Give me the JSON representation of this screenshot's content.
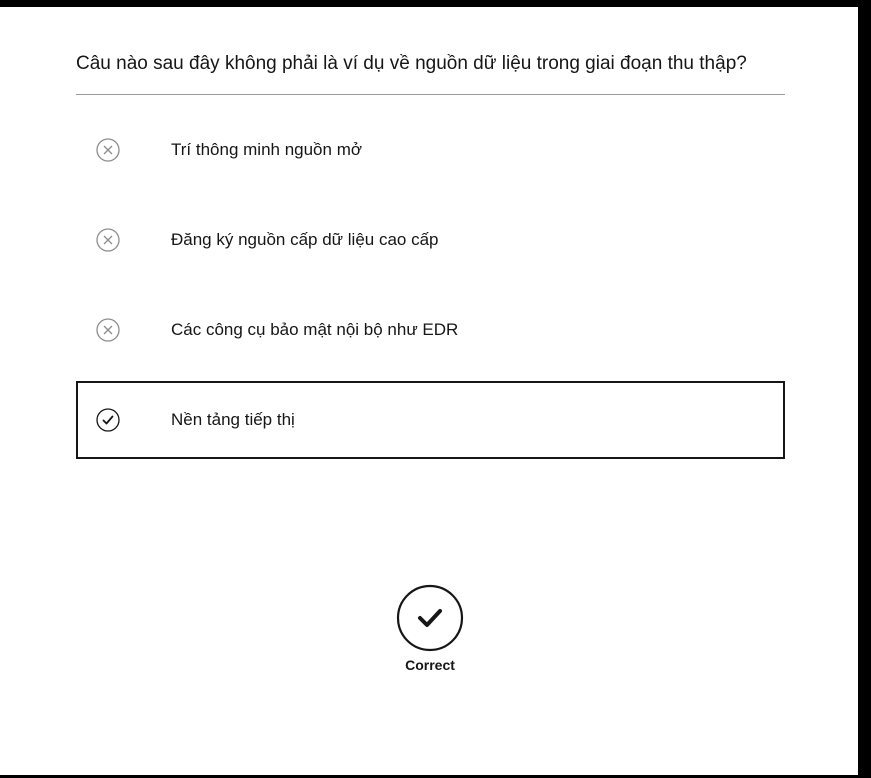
{
  "question": {
    "text": "Câu nào sau đây không phải là ví dụ về nguồn dữ liệu trong giai đoạn thu thập?"
  },
  "options": [
    {
      "label": "Trí thông minh nguồn mở",
      "state": "incorrect",
      "icon": "x-circle-icon"
    },
    {
      "label": "Đăng ký nguồn cấp dữ liệu cao cấp",
      "state": "incorrect",
      "icon": "x-circle-icon"
    },
    {
      "label": "Các công cụ bảo mật nội bộ như EDR",
      "state": "incorrect",
      "icon": "x-circle-icon"
    },
    {
      "label": "Nền tảng tiếp thị",
      "state": "selected-correct",
      "icon": "check-circle-icon"
    }
  ],
  "result": {
    "label": "Correct",
    "icon": "checkmark-circle-icon"
  },
  "colors": {
    "text": "#161616",
    "icon_muted": "#8d8d8d",
    "divider": "#9a9a9a",
    "frame": "#000000",
    "panel": "#ffffff"
  }
}
